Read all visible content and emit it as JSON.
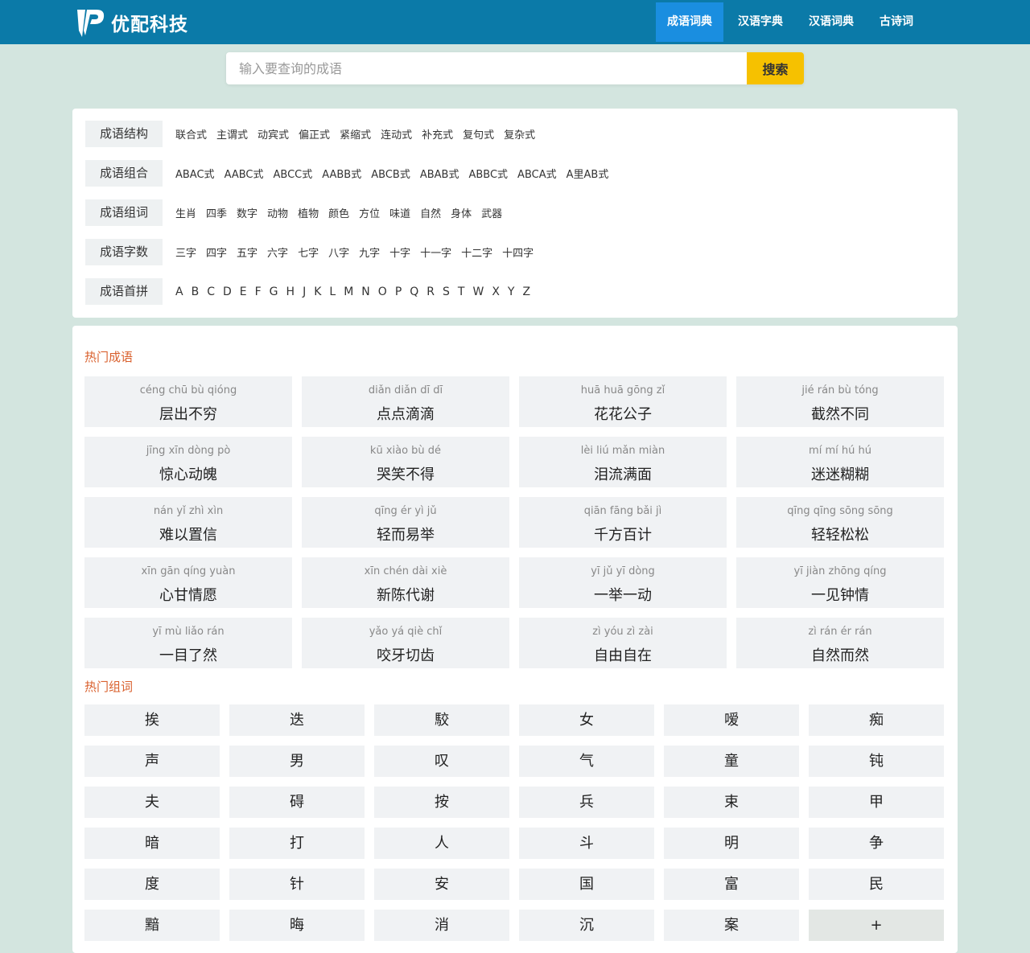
{
  "brand": {
    "name": "优配科技"
  },
  "nav": [
    {
      "label": "成语词典",
      "active": true
    },
    {
      "label": "汉语字典",
      "active": false
    },
    {
      "label": "汉语词典",
      "active": false
    },
    {
      "label": "古诗词",
      "active": false
    }
  ],
  "search": {
    "placeholder": "输入要查询的成语",
    "value": "",
    "button": "搜索"
  },
  "categories": [
    {
      "label": "成语结构",
      "links": [
        "联合式",
        "主谓式",
        "动宾式",
        "偏正式",
        "紧缩式",
        "连动式",
        "补充式",
        "复句式",
        "复杂式"
      ]
    },
    {
      "label": "成语组合",
      "links": [
        "ABAC式",
        "AABC式",
        "ABCC式",
        "AABB式",
        "ABCB式",
        "ABAB式",
        "ABBC式",
        "ABCA式",
        "A里AB式"
      ]
    },
    {
      "label": "成语组词",
      "links": [
        "生肖",
        "四季",
        "数字",
        "动物",
        "植物",
        "颜色",
        "方位",
        "味道",
        "自然",
        "身体",
        "武器"
      ]
    },
    {
      "label": "成语字数",
      "links": [
        "三字",
        "四字",
        "五字",
        "六字",
        "七字",
        "八字",
        "九字",
        "十字",
        "十一字",
        "十二字",
        "十四字"
      ]
    },
    {
      "label": "成语首拼",
      "links": [
        "A",
        "B",
        "C",
        "D",
        "E",
        "F",
        "G",
        "H",
        "J",
        "K",
        "L",
        "M",
        "N",
        "O",
        "P",
        "Q",
        "R",
        "S",
        "T",
        "W",
        "X",
        "Y",
        "Z"
      ]
    }
  ],
  "hot_idioms": {
    "title": "热门成语",
    "items": [
      {
        "pinyin": "céng chū bù qióng",
        "word": "层出不穷"
      },
      {
        "pinyin": "diǎn diǎn dī dī",
        "word": "点点滴滴"
      },
      {
        "pinyin": "huā huā gōng zǐ",
        "word": "花花公子"
      },
      {
        "pinyin": "jié rán bù tóng",
        "word": "截然不同"
      },
      {
        "pinyin": "jīng xīn dòng pò",
        "word": "惊心动魄"
      },
      {
        "pinyin": "kū xiào bù dé",
        "word": "哭笑不得"
      },
      {
        "pinyin": "lèi liú mǎn miàn",
        "word": "泪流满面"
      },
      {
        "pinyin": "mí mí hú hú",
        "word": "迷迷糊糊"
      },
      {
        "pinyin": "nán yǐ zhì xìn",
        "word": "难以置信"
      },
      {
        "pinyin": "qīng ér yì jǔ",
        "word": "轻而易举"
      },
      {
        "pinyin": "qiān fāng bǎi jì",
        "word": "千方百计"
      },
      {
        "pinyin": "qīng qīng sōng sōng",
        "word": "轻轻松松"
      },
      {
        "pinyin": "xīn gān qíng yuàn",
        "word": "心甘情愿"
      },
      {
        "pinyin": "xīn chén dài xiè",
        "word": "新陈代谢"
      },
      {
        "pinyin": "yī jǔ yī dòng",
        "word": "一举一动"
      },
      {
        "pinyin": "yī jiàn zhōng qíng",
        "word": "一见钟情"
      },
      {
        "pinyin": "yī mù liǎo rán",
        "word": "一目了然"
      },
      {
        "pinyin": "yǎo yá qiè chǐ",
        "word": "咬牙切齿"
      },
      {
        "pinyin": "zì yóu zì zài",
        "word": "自由自在"
      },
      {
        "pinyin": "zì rán ér rán",
        "word": "自然而然"
      }
    ]
  },
  "hot_chars": {
    "title": "热门组词",
    "items": [
      "挨",
      "迭",
      "駮",
      "女",
      "嗳",
      "痴",
      "声",
      "男",
      "叹",
      "气",
      "童",
      "钝",
      "夫",
      "碍",
      "按",
      "兵",
      "束",
      "甲",
      "暗",
      "打",
      "人",
      "斗",
      "明",
      "争",
      "度",
      "针",
      "安",
      "国",
      "富",
      "民",
      "黯",
      "晦",
      "消",
      "沉",
      "案"
    ],
    "more": "+"
  }
}
